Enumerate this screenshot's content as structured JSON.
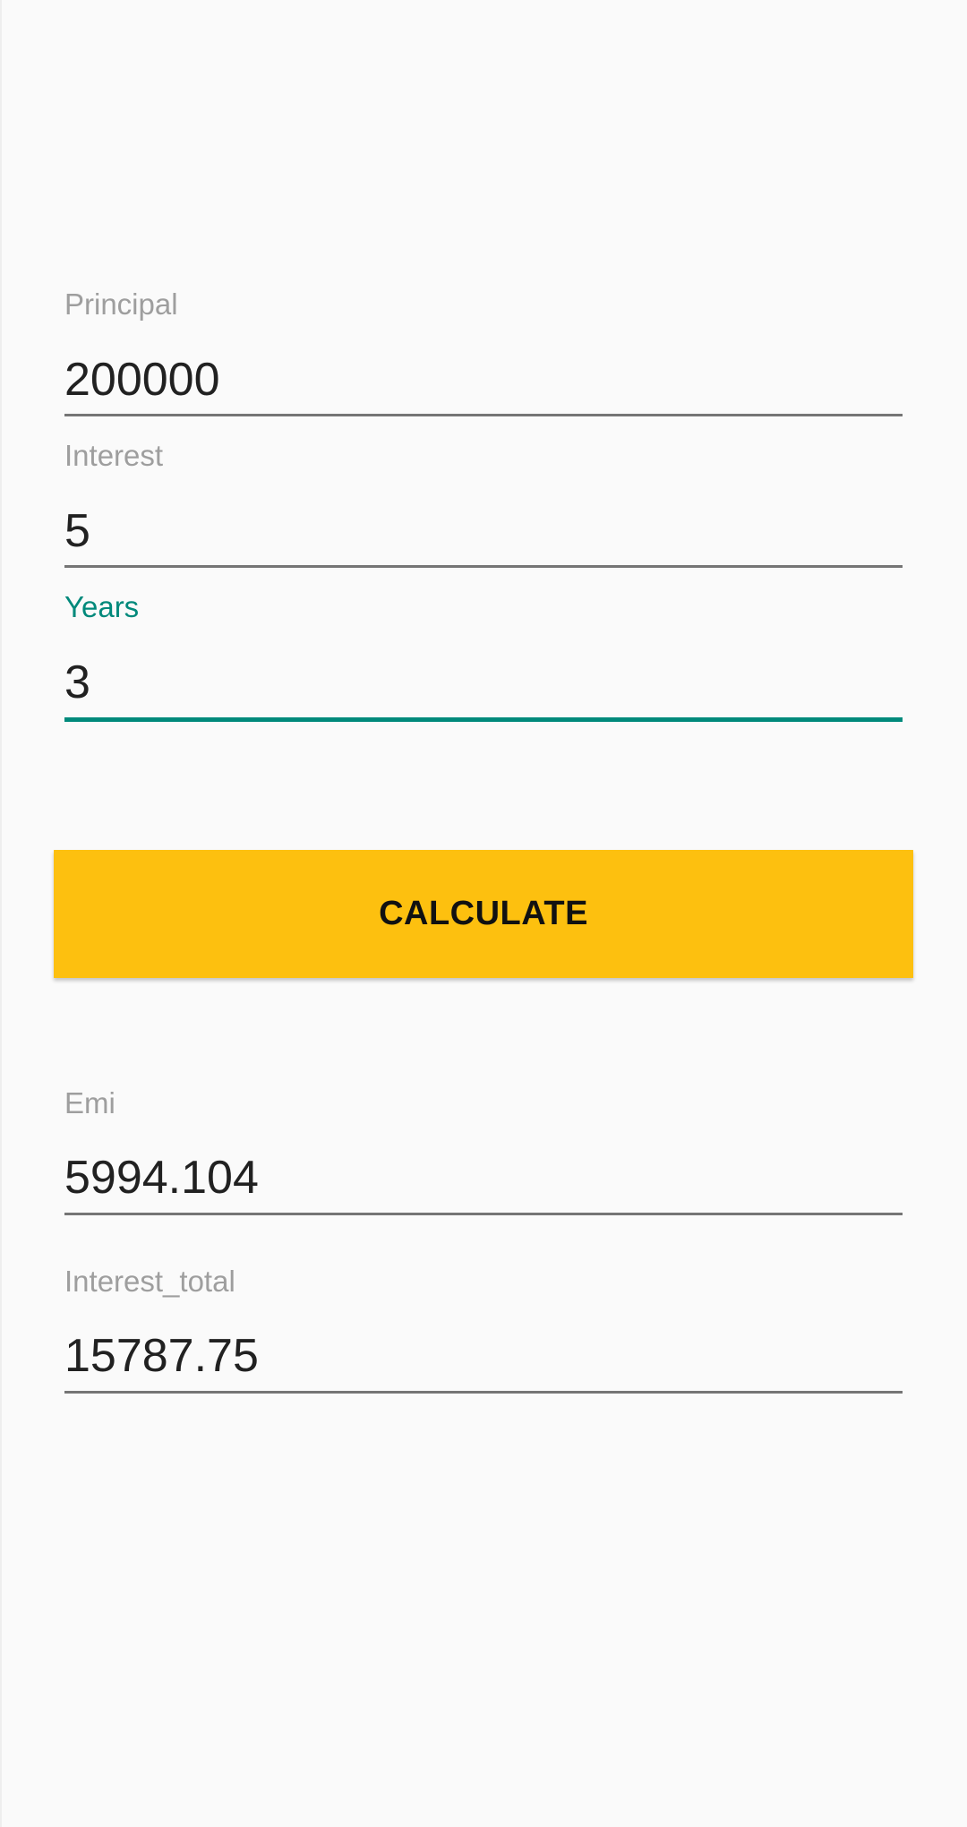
{
  "form": {
    "principal": {
      "label": "Principal",
      "value": "200000"
    },
    "interest": {
      "label": "Interest",
      "value": "5"
    },
    "years": {
      "label": "Years",
      "value": "3"
    }
  },
  "calculate_button": {
    "label": "CALCULATE"
  },
  "results": {
    "emi": {
      "label": "Emi",
      "value": "5994.104"
    },
    "interest_total": {
      "label": "Interest_total",
      "value": "15787.75"
    }
  },
  "colors": {
    "accent": "#00897b",
    "button": "#fdc00f",
    "background": "#fafafa",
    "hint_text": "#9e9e9e",
    "value_text": "#212121"
  }
}
